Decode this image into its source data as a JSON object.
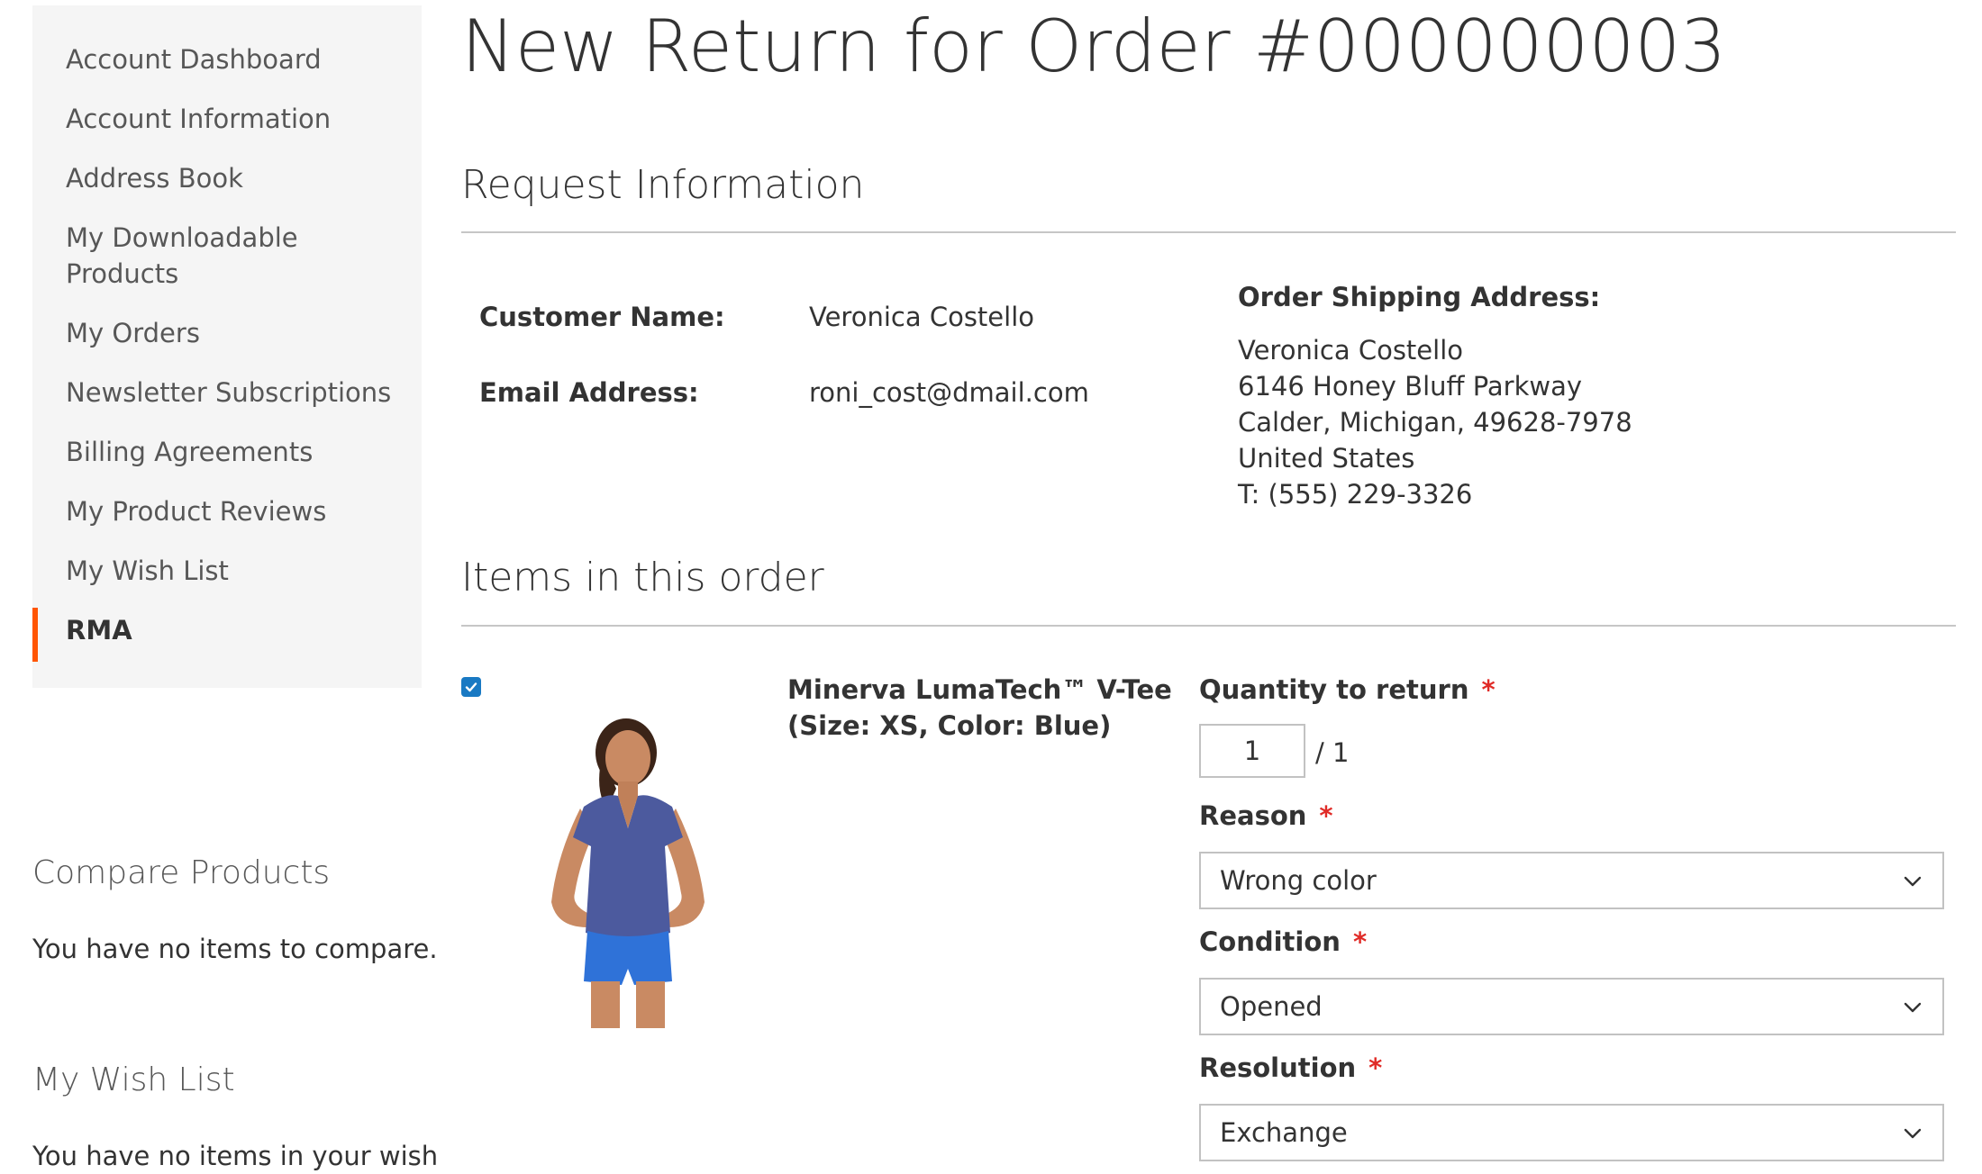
{
  "sidebar": {
    "nav_items": [
      {
        "label": "Account Dashboard"
      },
      {
        "label": "Account Information"
      },
      {
        "label": "Address Book"
      },
      {
        "label": "My Downloadable Products"
      },
      {
        "label": "My Orders"
      },
      {
        "label": "Newsletter Subscriptions"
      },
      {
        "label": "Billing Agreements"
      },
      {
        "label": "My Product Reviews"
      },
      {
        "label": "My Wish List"
      },
      {
        "label": "RMA",
        "active": true
      }
    ],
    "compare": {
      "title": "Compare Products",
      "empty_text": "You have no items to compare."
    },
    "wishlist": {
      "title": "My Wish List",
      "empty_text": "You have no items in your wish"
    }
  },
  "page": {
    "title": "New Return for Order #000000003"
  },
  "request_info": {
    "section_title": "Request Information",
    "customer_name_label": "Customer Name:",
    "customer_name": "Veronica Costello",
    "email_label": "Email Address:",
    "email": "roni_cost@dmail.com",
    "shipping_label": "Order Shipping Address:",
    "shipping_lines": [
      "Veronica Costello",
      "6146 Honey Bluff Parkway",
      "Calder, Michigan, 49628-7978",
      "United States",
      "T: (555) 229-3326"
    ]
  },
  "items": {
    "section_title": "Items in this order",
    "product": {
      "selected": true,
      "name": "Minerva LumaTech™ V-Tee",
      "options": "(Size: XS, Color: Blue)"
    },
    "qty": {
      "label": "Quantity to return",
      "required_mark": "*",
      "value": "1",
      "max_text": "/ 1"
    },
    "reason": {
      "label": "Reason",
      "required_mark": "*",
      "selected": "Wrong color"
    },
    "condition": {
      "label": "Condition",
      "required_mark": "*",
      "selected": "Opened"
    },
    "resolution": {
      "label": "Resolution",
      "required_mark": "*",
      "selected": "Exchange"
    }
  },
  "colors": {
    "accent_orange": "#ff5501",
    "checkbox_blue": "#1979c3",
    "required_red": "#e02b27",
    "sidebar_bg": "#f5f5f5"
  },
  "icons": {
    "checkbox": "checkmark-icon",
    "select": "chevron-down-icon"
  }
}
